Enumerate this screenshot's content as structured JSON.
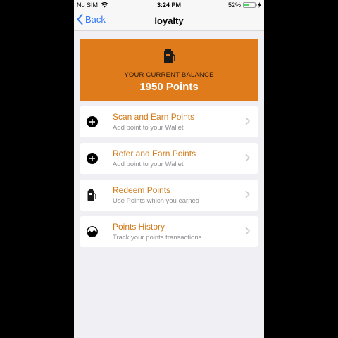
{
  "status_bar": {
    "carrier": "No SIM",
    "time": "3:24 PM",
    "battery_percent": "52%",
    "battery_level": 0.52
  },
  "nav": {
    "back_label": "Back",
    "title": "loyalty"
  },
  "balance": {
    "label": "YOUR CURRENT BALANCE",
    "value": "1950 Points",
    "card_color": "#e07b1c"
  },
  "menu": [
    {
      "title": "Scan and Earn Points",
      "subtitle": "Add point to your Wallet",
      "icon": "plus-circle-icon"
    },
    {
      "title": "Refer and Earn Points",
      "subtitle": "Add point to your Wallet",
      "icon": "plus-circle-icon"
    },
    {
      "title": "Redeem Points",
      "subtitle": "Use Points which you earned",
      "icon": "fuel-jar-icon"
    },
    {
      "title": "Points History",
      "subtitle": "Track your points transactions",
      "icon": "history-chart-icon"
    }
  ],
  "colors": {
    "accent": "#d07a1a",
    "link": "#3478f6",
    "background": "#efeff4"
  }
}
